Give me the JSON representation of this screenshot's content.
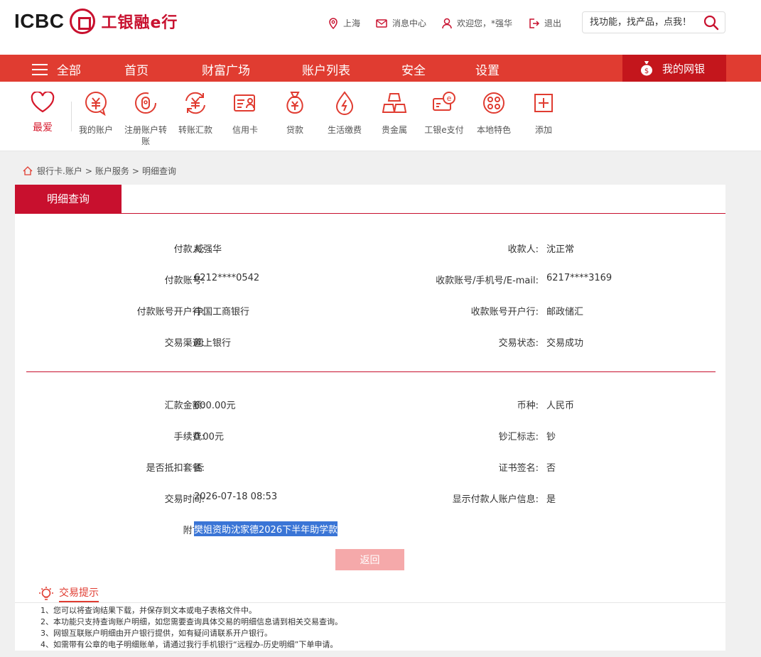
{
  "header": {
    "logo_text": "ICBC",
    "logo_cn": "工银融e行",
    "location": "上海",
    "messages": "消息中心",
    "welcome": "欢迎您，*强华",
    "logout": "退出",
    "search_placeholder": "找功能，找产品，点我！"
  },
  "nav": {
    "all": "全部",
    "items": [
      "首页",
      "财富广场",
      "账户列表",
      "安全",
      "设置"
    ],
    "my_bank": "我的网银"
  },
  "favorites": {
    "label": "最爱",
    "items": [
      {
        "label": "我的账户",
        "icon": "yuan-bubble-icon"
      },
      {
        "label": "注册账户转账",
        "icon": "transfer-register-icon"
      },
      {
        "label": "转账汇款",
        "icon": "yuan-cycle-icon"
      },
      {
        "label": "信用卡",
        "icon": "credit-card-icon"
      },
      {
        "label": "贷款",
        "icon": "money-bag-icon"
      },
      {
        "label": "生活缴费",
        "icon": "utility-drop-icon"
      },
      {
        "label": "贵金属",
        "icon": "gold-bars-icon"
      },
      {
        "label": "工银e支付",
        "icon": "e-pay-icon"
      },
      {
        "label": "本地特色",
        "icon": "local-feature-icon"
      },
      {
        "label": "添加",
        "icon": "add-icon"
      }
    ]
  },
  "breadcrumb": [
    "银行卡.账户",
    "账户服务",
    "明细查询"
  ],
  "panel": {
    "tab": "明细查询",
    "left_top": [
      {
        "label": "付款人:",
        "value": "臧强华"
      },
      {
        "label": "付款账号:",
        "value": "6212****0542"
      },
      {
        "label": "付款账号开户行:",
        "value": "中国工商银行"
      },
      {
        "label": "交易渠道:",
        "value": "网上银行"
      }
    ],
    "right_top": [
      {
        "label": "收款人:",
        "value": "沈正常"
      },
      {
        "label": "收款账号/手机号/E-mail:",
        "value": "6217****3169"
      },
      {
        "label": "收款账号开户行:",
        "value": "邮政储汇"
      },
      {
        "label": "交易状态:",
        "value": "交易成功"
      }
    ],
    "left_bottom": [
      {
        "label": "汇款金额:",
        "value": "600.00元"
      },
      {
        "label": "手续费:",
        "value": "0.00元"
      },
      {
        "label": "是否抵扣套餐:",
        "value": "否"
      },
      {
        "label": "交易时间:",
        "value": "2026-07-18 08:53"
      }
    ],
    "right_bottom": [
      {
        "label": "币种:",
        "value": "人民币"
      },
      {
        "label": "钞汇标志:",
        "value": "钞"
      },
      {
        "label": "证书签名:",
        "value": "否"
      },
      {
        "label": "显示付款人账户信息:",
        "value": "是"
      }
    ],
    "memo_label": "附言:",
    "memo_value": "樊姐资助沈家德2026下半年助学款",
    "back": "返回"
  },
  "tips": {
    "title": "交易提示",
    "items": [
      "1、您可以将查询结果下载，并保存到文本或电子表格文件中。",
      "2、本功能只支持查询账户明细，如您需要查询具体交易的明细信息请到相关交易查询。",
      "3、网银互联账户明细由开户银行提供，如有疑问请联系开户银行。",
      "4、如需带有公章的电子明细账单，请通过我行手机银行“远程办-历史明细”下单申请。"
    ]
  },
  "colors": {
    "brand_red": "#e03c31",
    "dark_red": "#c8102e",
    "highlight": "#3a75d6"
  }
}
